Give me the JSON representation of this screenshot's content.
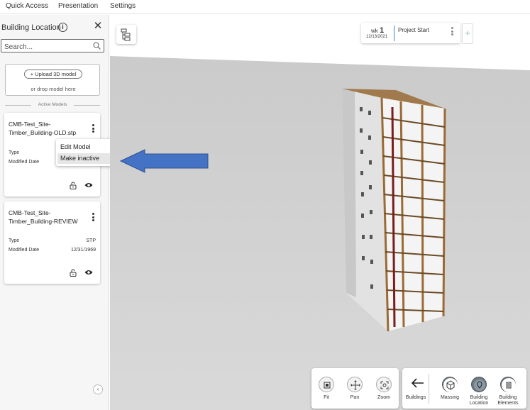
{
  "menu": {
    "quick_access": "Quick Access",
    "presentation": "Presentation",
    "settings": "Settings"
  },
  "sidebar": {
    "title": "Building Location",
    "search_placeholder": "Search...",
    "upload_label": "+ Upload 3D model",
    "upload_hint": "or drop model here",
    "section_label": "Active Models",
    "models": [
      {
        "name": "CMB-Test_Site-Timber_Building-OLD.stp",
        "type_label": "Type",
        "type_value": "",
        "date_label": "Modified Date",
        "date_value": ""
      },
      {
        "name": "CMB-Test_Site-Timber_Building-REVIEW",
        "type_label": "Type",
        "type_value": "STP",
        "date_label": "Modified Date",
        "date_value": "12/31/1969"
      }
    ],
    "context_menu": {
      "edit": "Edit Model",
      "make_inactive": "Make inactive"
    }
  },
  "timeline": {
    "wk_label": "wk",
    "wk_number": "1",
    "date": "12/13/2021",
    "title": "Project Start"
  },
  "toolbar": {
    "fit": "Fit",
    "pan": "Pan",
    "zoom": "Zoom",
    "buildings": "Buildings",
    "massing": "Massing",
    "building_location": "Building Location",
    "building_elements": "Building Elements"
  },
  "colors": {
    "annotation_arrow": "#4472C4",
    "viewport_bg": "#d4d4d4",
    "timber": "#b07a3c"
  }
}
